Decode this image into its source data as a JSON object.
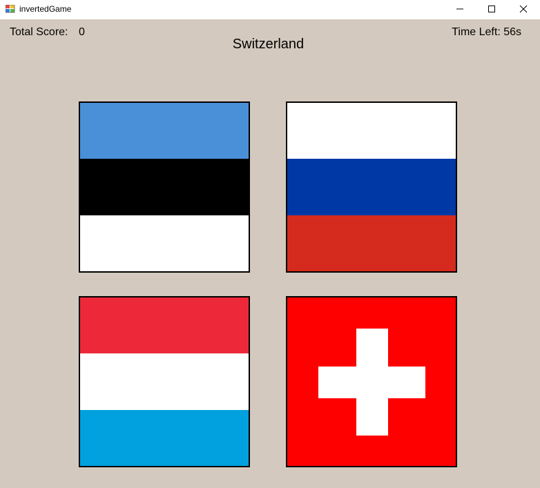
{
  "window": {
    "title": "invertedGame",
    "icon": "app-icon",
    "controls": [
      "minimize-icon",
      "maximize-icon",
      "close-icon"
    ]
  },
  "score": {
    "label": "Total Score:",
    "value": "0"
  },
  "timer": {
    "text": "Time Left: 56s"
  },
  "prompt": {
    "country": "Switzerland"
  },
  "flags": [
    {
      "country": "Estonia",
      "stripes": [
        "#4a90d9",
        "#000000",
        "#ffffff"
      ]
    },
    {
      "country": "Russia",
      "stripes": [
        "#ffffff",
        "#0039a6",
        "#d52b1e"
      ]
    },
    {
      "country": "Luxembourg",
      "stripes": [
        "#ed2939",
        "#ffffff",
        "#00a1de"
      ]
    },
    {
      "country": "Switzerland",
      "background": "#ff0000",
      "cross": "#ffffff"
    }
  ],
  "colors": {
    "background": "#d4c9be",
    "titlebar": "#ffffff",
    "border": "#000000"
  }
}
